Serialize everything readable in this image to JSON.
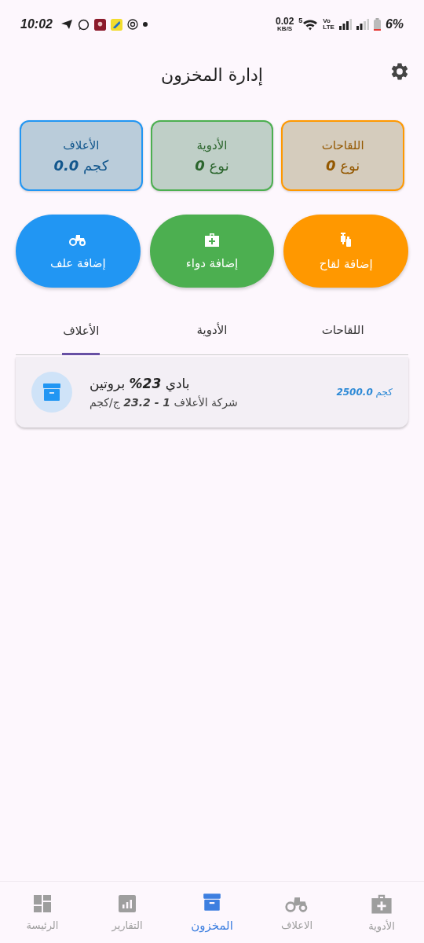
{
  "status_bar": {
    "time": "10:02",
    "speed": "0.02",
    "speed_unit": "KB/S",
    "wifi_label": "5",
    "volte_top": "Vo",
    "volte_bottom": "LTE",
    "battery": "6%"
  },
  "header": {
    "title": "إدارة المخزون"
  },
  "stats": [
    {
      "label": "اللقاحات",
      "value": "نوع **0**",
      "color": "#ff9800"
    },
    {
      "label": "الأدوية",
      "value": "نوع **0**",
      "color": "#4caf50"
    },
    {
      "label": "الأعلاف",
      "value": "كجم **0.0**",
      "color": "#2196f3"
    }
  ],
  "actions": [
    {
      "kind": "vaccine",
      "label": "إضافة لقاح",
      "color": "#ff9800"
    },
    {
      "kind": "medicine",
      "label": "إضافة دواء",
      "color": "#4caf50"
    },
    {
      "kind": "feed",
      "label": "إضافة علف",
      "color": "#2196f3"
    }
  ],
  "tabs": [
    {
      "label": "اللقاحات",
      "selected": false
    },
    {
      "label": "الأدوية",
      "selected": false
    },
    {
      "label": "الأعلاف",
      "selected": true
    }
  ],
  "items": [
    {
      "title": "بادي **23%** بروتين",
      "subtitle": "شركة الأعلاف **1 - 23.2** ج/كجم",
      "amount": "كجم **2500.0**"
    }
  ],
  "nav": [
    {
      "kind": "medicine",
      "label": "الأدوية",
      "selected": false
    },
    {
      "kind": "feed",
      "label": "الاعلاف",
      "selected": false
    },
    {
      "kind": "inventory",
      "label": "المخزون",
      "selected": true
    },
    {
      "kind": "reports",
      "label": "التقارير",
      "selected": false
    },
    {
      "kind": "home",
      "label": "الرئيسة",
      "selected": false
    }
  ]
}
